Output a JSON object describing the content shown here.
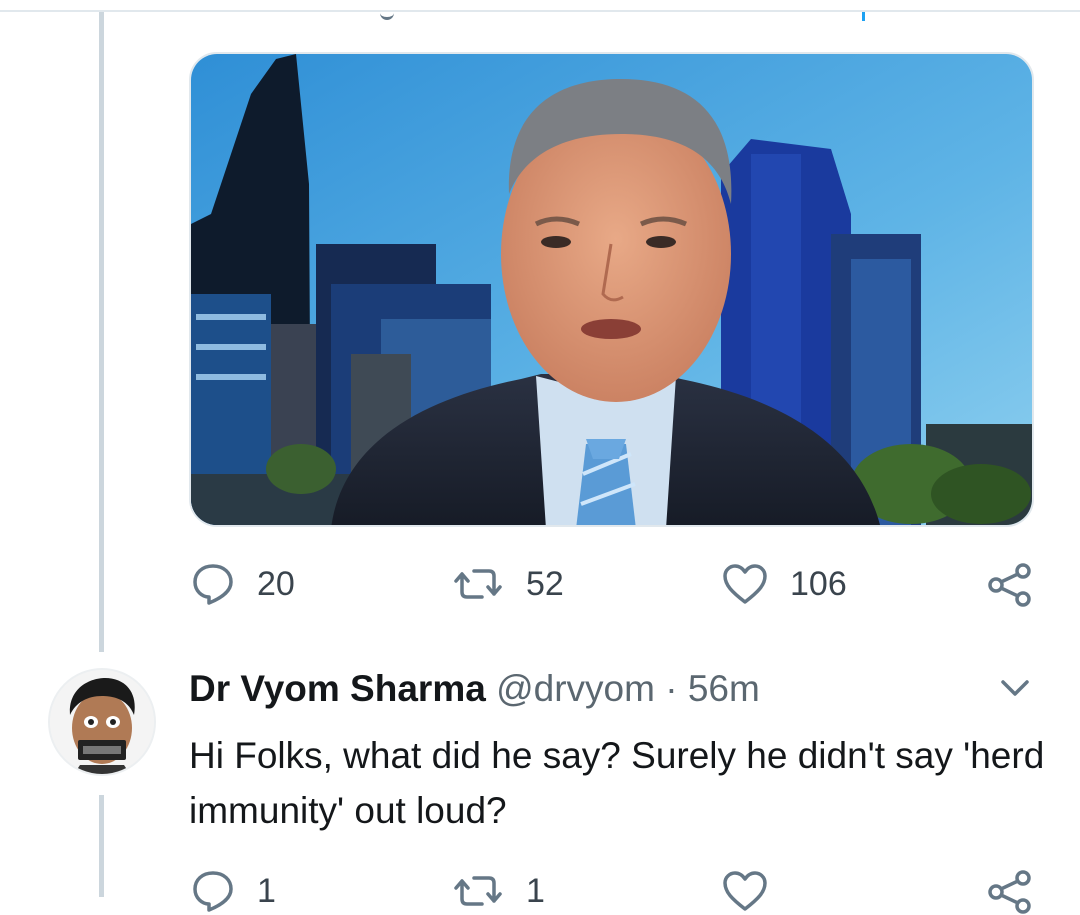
{
  "tweet": {
    "actions": {
      "reply_count": "20",
      "retweet_count": "52",
      "like_count": "106"
    }
  },
  "reply": {
    "name": "Dr Vyom Sharma",
    "handle": "@drvyom",
    "separator": " · ",
    "time": "56m",
    "text": "Hi Folks, what did he say? Surely he didn't say 'herd immunity' out loud?",
    "actions": {
      "reply_count": "1",
      "retweet_count": "1",
      "like_count": ""
    }
  },
  "icons": [
    "reply-icon",
    "retweet-icon",
    "like-icon",
    "share-icon",
    "chevron-down-icon"
  ],
  "colors": {
    "thread_line": "#ccd6dd",
    "icon_gray": "#657786",
    "text_primary": "#14171a",
    "text_secondary": "#5b6770"
  }
}
